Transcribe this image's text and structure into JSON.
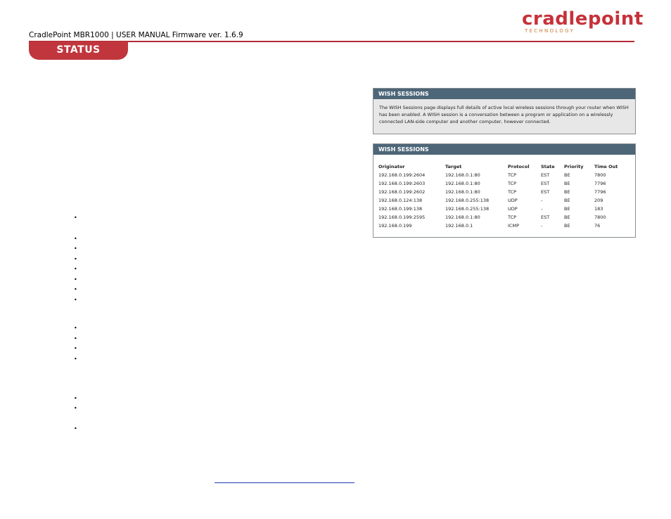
{
  "header": {
    "doc_title": "CradlePoint MBR1000 | USER MANUAL Firmware ver. 1.6.9",
    "logo_word": "cradlepoint",
    "logo_sub": "TECHNOLOGY",
    "section_tab": "STATUS"
  },
  "info_panel": {
    "title": "WISH SESSIONS",
    "description": "The WISH Sessions page displays full details of active local wireless sessions through your router when WISH has been enabled. A WISH session is a conversation between a program or application on a wirelessly connected LAN-side computer and another computer, however connected."
  },
  "sessions_panel": {
    "title": "WISH SESSIONS",
    "columns": [
      "Originator",
      "Target",
      "Protocol",
      "State",
      "Priority",
      "Time Out"
    ],
    "rows": [
      [
        "192.168.0.199:2604",
        "192.168.0.1:80",
        "TCP",
        "EST",
        "BE",
        "7800"
      ],
      [
        "192.168.0.199:2603",
        "192.168.0.1:80",
        "TCP",
        "EST",
        "BE",
        "7796"
      ],
      [
        "192.168.0.199:2602",
        "192.168.0.1:80",
        "TCP",
        "EST",
        "BE",
        "7796"
      ],
      [
        "192.168.0.124:138",
        "192.168.0.255:138",
        "UDP",
        "-",
        "BE",
        "209"
      ],
      [
        "192.168.0.199:138",
        "192.168.0.255:138",
        "UDP",
        "-",
        "BE",
        "183"
      ],
      [
        "192.168.0.199:2595",
        "192.168.0.1:80",
        "TCP",
        "EST",
        "BE",
        "7800"
      ],
      [
        "192.168.0.199",
        "192.168.0.1",
        "ICMP",
        "-",
        "BE",
        "76"
      ]
    ]
  },
  "bullet_glyph": "•",
  "colors": {
    "brand_red": "#c1363d",
    "panel_header": "#4d6678",
    "link_blue": "#1e3cb4"
  }
}
